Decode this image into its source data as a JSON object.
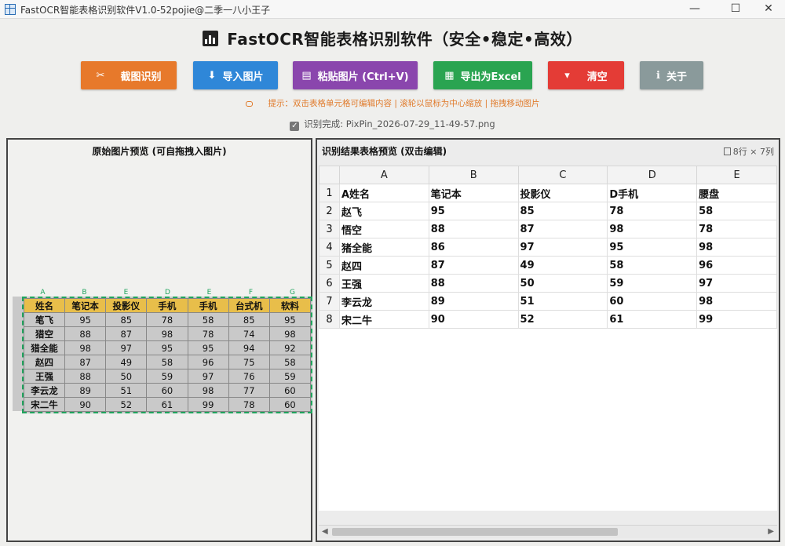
{
  "window": {
    "title": "FastOCR智能表格识别软件V1.0-52pojie@二季一八小王子",
    "min": "—",
    "max": "☐",
    "close": "✕"
  },
  "header": {
    "title": "FastOCR智能表格识别软件（安全•稳定•高效）"
  },
  "toolbar": {
    "screenshot": {
      "icon": "✂",
      "label": "截图识别"
    },
    "import": {
      "icon": "⬇",
      "label": "导入图片"
    },
    "paste": {
      "icon": "▤",
      "label": "粘贴图片 (Ctrl+V)"
    },
    "export": {
      "icon": "▦",
      "label": "导出为Excel"
    },
    "clear": {
      "icon": "▾",
      "label": "清空"
    },
    "about": {
      "icon": "ℹ",
      "label": "关于"
    }
  },
  "tip": "提示：双击表格单元格可编辑内容 | 滚轮以鼠标为中心缩放 | 拖拽移动图片",
  "status": "识别完成: PixPin_2026-07-29_11-49-57.png",
  "left_panel": {
    "title": "原始图片预览 (可自拖拽入图片)",
    "col_letters": [
      "A",
      "B",
      "E",
      "D",
      "E",
      "F",
      "G"
    ],
    "header": [
      "姓名",
      "笔记本",
      "投影仪",
      "手机",
      "手机",
      "台式机",
      "软料"
    ],
    "rows": [
      [
        "笔飞",
        "95",
        "85",
        "78",
        "58",
        "85",
        "95"
      ],
      [
        "猎空",
        "88",
        "87",
        "98",
        "78",
        "74",
        "98"
      ],
      [
        "猎全能",
        "98",
        "97",
        "95",
        "95",
        "94",
        "92"
      ],
      [
        "赵四",
        "87",
        "49",
        "58",
        "96",
        "75",
        "58"
      ],
      [
        "王强",
        "88",
        "50",
        "59",
        "97",
        "76",
        "59"
      ],
      [
        "李云龙",
        "89",
        "51",
        "60",
        "98",
        "77",
        "60"
      ],
      [
        "宋二牛",
        "90",
        "52",
        "61",
        "99",
        "78",
        "60"
      ]
    ]
  },
  "right_panel": {
    "title": "识别结果表格预览 (双击编辑)",
    "dims": "8行 × 7列",
    "columns": [
      "A",
      "B",
      "C",
      "D",
      "E"
    ],
    "rows": [
      {
        "n": "1",
        "cells": [
          "A姓名",
          "笔记本",
          "投影仪",
          "D手机",
          "腰盘"
        ]
      },
      {
        "n": "2",
        "cells": [
          "赵飞",
          "95",
          "85",
          "78",
          "58"
        ]
      },
      {
        "n": "3",
        "cells": [
          "悟空",
          "88",
          "87",
          "98",
          "78"
        ]
      },
      {
        "n": "4",
        "cells": [
          "猪全能",
          "86",
          "97",
          "95",
          "98"
        ]
      },
      {
        "n": "5",
        "cells": [
          "赵四",
          "87",
          "49",
          "58",
          "96"
        ]
      },
      {
        "n": "6",
        "cells": [
          "王强",
          "88",
          "50",
          "59",
          "97"
        ]
      },
      {
        "n": "7",
        "cells": [
          "李云龙",
          "89",
          "51",
          "60",
          "98"
        ]
      },
      {
        "n": "8",
        "cells": [
          "宋二牛",
          "90",
          "52",
          "61",
          "99"
        ]
      }
    ]
  }
}
